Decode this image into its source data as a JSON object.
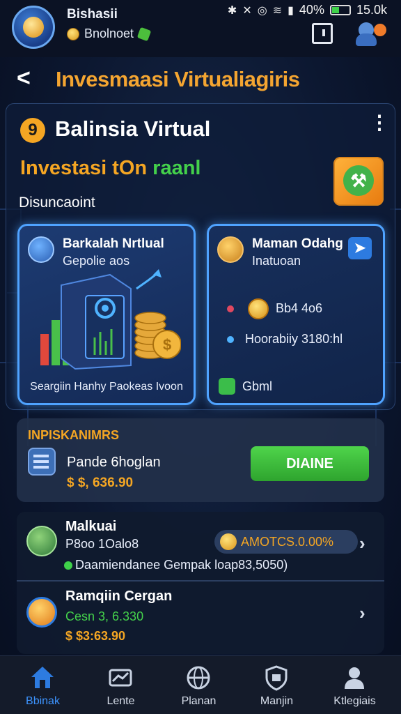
{
  "status_bar": {
    "battery": "40%",
    "speed": "15.0k",
    "battery_level": 0.4
  },
  "header": {
    "app_name": "Bishasii",
    "app_sub": "Bnolnoet"
  },
  "title_row": {
    "back_glyph": "<",
    "title": "Invesmaasi Virtualiagiris"
  },
  "panel": {
    "badge_number": "9",
    "title": "Balinsia Virtual",
    "invest_title_main": "Investasi tOn ",
    "invest_title_accent": "raanl",
    "discount_label": "Disuncaoint",
    "card_left": {
      "title": "Barkalah Nrtlual",
      "subtitle": "Gepolie aos",
      "footer": "Seargiin Hanhy Paokeas Ivoon"
    },
    "card_right": {
      "title": "Maman Odahg",
      "subtitle": "Inatuoan",
      "line1": "Bb4 4o6",
      "line2": "Hoorabiiy 3180:hl",
      "option": "Gbml"
    }
  },
  "in_progress": {
    "label": "INPISKANIMRS",
    "name": "Pande 6hoglan",
    "price": "$ $, 636.90",
    "button": "DIAINE"
  },
  "list": {
    "items": [
      {
        "title": "Malkuai",
        "line1": "P8oo 1Oalo8",
        "pill": "AMOTCS.0.00%",
        "line2": "Daamiendanee Gempak loap83,5050)"
      },
      {
        "title": "Ramqiin Cergan",
        "line1": "Cesn 3, 6.330",
        "line2": "$ $3:63.90"
      }
    ]
  },
  "bottom_nav": {
    "items": [
      {
        "label": "Bbinak",
        "icon": "home-icon"
      },
      {
        "label": "Lente",
        "icon": "ticket-icon"
      },
      {
        "label": "Planan",
        "icon": "globe-icon"
      },
      {
        "label": "Manjin",
        "icon": "shield-icon"
      },
      {
        "label": "Ktlegiais",
        "icon": "user-icon"
      }
    ]
  },
  "colors": {
    "accent_orange": "#f5a623",
    "accent_green": "#44d14b",
    "accent_blue": "#3d94ff",
    "background": "#0c1730"
  }
}
